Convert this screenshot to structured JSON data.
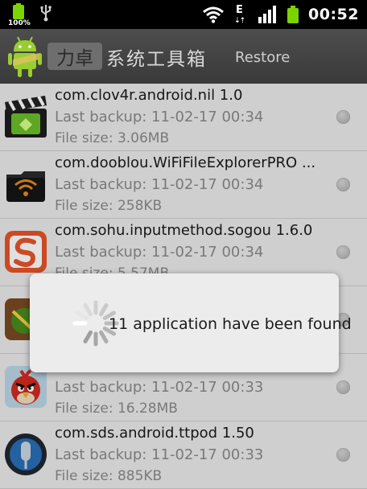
{
  "status_bar": {
    "battery_small_label": "100%",
    "network_type": "E",
    "network_arrows": "⇣⇡",
    "time": "00:52"
  },
  "header": {
    "title_prefix": "力卓",
    "title_rest": "系统工具箱",
    "action": "Restore"
  },
  "apps": [
    {
      "name": "com.clov4r.android.nil 1.0",
      "backup": "Last backup:  11-02-17 00:34",
      "size": "File size: 3.06MB",
      "icon": "clapperboard-icon"
    },
    {
      "name": "com.dooblou.WiFiFileExplorerPRO ...",
      "backup": "Last backup:  11-02-17 00:34",
      "size": "File size: 258KB",
      "icon": "wifi-folder-icon"
    },
    {
      "name": "com.sohu.inputmethod.sogou 1.6.0",
      "backup": "Last backup:  11-02-17 00:34",
      "size": "File size: 5.57MB",
      "icon": "sogou-icon"
    },
    {
      "name": "",
      "backup": "",
      "size": "",
      "icon": "fruit-ninja-icon"
    },
    {
      "name": "",
      "backup": "Last backup:  11-02-17 00:33",
      "size": "File size: 16.28MB",
      "icon": "angry-bird-icon"
    },
    {
      "name": "com.sds.android.ttpod 1.50",
      "backup": "Last backup:  11-02-17 00:33",
      "size": "File size: 885KB",
      "icon": "ttpod-icon"
    }
  ],
  "dialog": {
    "message": "11 application have been found"
  },
  "colors": {
    "accent_green": "#7bd300",
    "title_bar": "#454545",
    "list_bg": "#ececec"
  }
}
